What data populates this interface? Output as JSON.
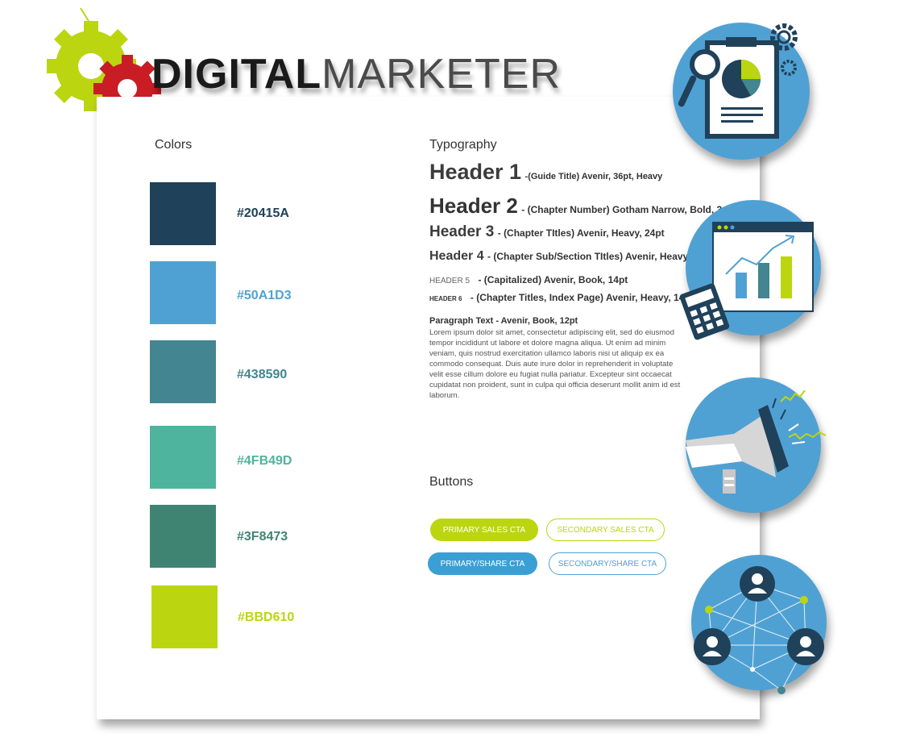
{
  "logo": {
    "part1": "DIGITAL",
    "part2": "MARKETER"
  },
  "colors": {
    "title": "Colors",
    "swatches": [
      {
        "hex": "#20415A",
        "label": "#20415A"
      },
      {
        "hex": "#50A1D3",
        "label": "#50A1D3"
      },
      {
        "hex": "#438590",
        "label": "#438590"
      },
      {
        "hex": "#4FB49D",
        "label": "#4FB49D"
      },
      {
        "hex": "#3F8473",
        "label": "#3F8473"
      },
      {
        "hex": "#BBD610",
        "label": "#BBD610"
      }
    ]
  },
  "typography": {
    "title": "Typography",
    "h1": {
      "label": "Header 1",
      "desc": "-(Guide Title) Avenir, 36pt, Heavy"
    },
    "h2": {
      "label": "Header 2",
      "desc": "- (Chapter Number) Gotham Narrow, Bold, 3"
    },
    "h3": {
      "label": "Header 3",
      "desc": "- (Chapter TItles) Avenir, Heavy, 24pt"
    },
    "h4": {
      "label": "Header 4",
      "desc": "- (Chapter Sub/Section TItles) Avenir, Heavy, 2"
    },
    "h5": {
      "label": "HEADER 5",
      "desc": "- (Capitalized) Avenir, Book, 14pt"
    },
    "h6": {
      "label": "HEADER 6",
      "desc": "- (Chapter Titles, Index Page) Avenir, Heavy, 14pt"
    },
    "paragraph_title": "Paragraph Text - Avenir, Book, 12pt",
    "paragraph_body": "Lorem ipsum dolor sit amet, consectetur adipiscing elit, sed do eiusmod tempor incididunt ut labore et dolore magna aliqua. Ut enim ad minim veniam, quis nostrud exercitation ullamco laboris nisi ut aliquip ex ea commodo consequat. Duis aute irure dolor in reprehenderit in voluptate velit esse cillum dolore eu fugiat nulla pariatur. Excepteur sint occaecat cupidatat non proident, sunt in culpa qui officia deserunt mollit anim id est laborum."
  },
  "buttons": {
    "title": "Buttons",
    "primary_sales": "PRIMARY SALES CTA",
    "secondary_sales": "SECONDARY SALES CTA",
    "primary_share": "PRIMARY/SHARE CTA",
    "secondary_share": "SECONDARY/SHARE CTA"
  },
  "icons": [
    "report-clipboard-icon",
    "analytics-dashboard-icon",
    "megaphone-icon",
    "network-people-icon"
  ]
}
